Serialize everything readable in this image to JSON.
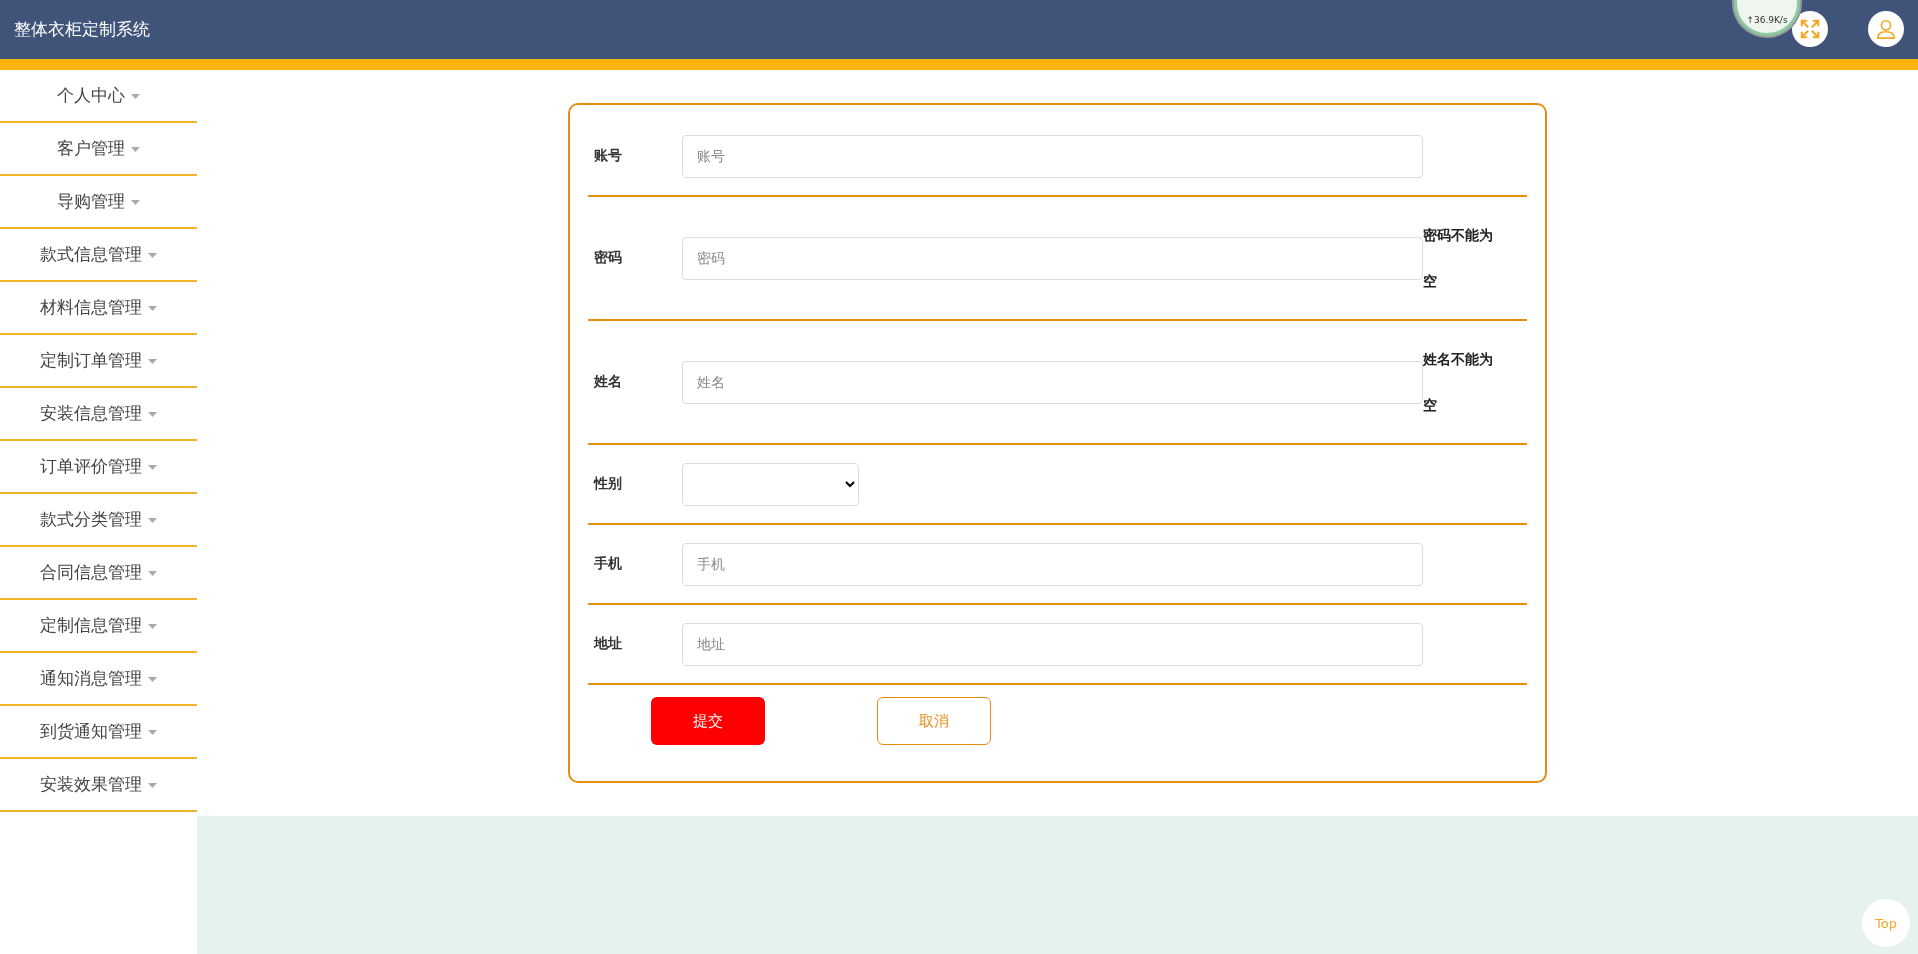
{
  "header": {
    "title": "整体衣柜定制系统",
    "speed_widget": "↑36.9K/s"
  },
  "sidebar": {
    "items": [
      {
        "label": "个人中心"
      },
      {
        "label": "客户管理"
      },
      {
        "label": "导购管理"
      },
      {
        "label": "款式信息管理"
      },
      {
        "label": "材料信息管理"
      },
      {
        "label": "定制订单管理"
      },
      {
        "label": "安装信息管理"
      },
      {
        "label": "订单评价管理"
      },
      {
        "label": "款式分类管理"
      },
      {
        "label": "合同信息管理"
      },
      {
        "label": "定制信息管理"
      },
      {
        "label": "通知消息管理"
      },
      {
        "label": "到货通知管理"
      },
      {
        "label": "安装效果管理"
      }
    ]
  },
  "form": {
    "fields": [
      {
        "kind": "text",
        "label": "账号",
        "placeholder": "账号"
      },
      {
        "kind": "text",
        "label": "密码",
        "placeholder": "密码",
        "error": "密码不能为空"
      },
      {
        "kind": "text",
        "label": "姓名",
        "placeholder": "姓名",
        "error": "姓名不能为空"
      },
      {
        "kind": "select",
        "label": "性别"
      },
      {
        "kind": "text",
        "label": "手机",
        "placeholder": "手机"
      },
      {
        "kind": "text",
        "label": "地址",
        "placeholder": "地址"
      }
    ],
    "buttons": [
      {
        "kind": "primary",
        "label": "提交"
      },
      {
        "kind": "outline",
        "label": "取消"
      }
    ]
  },
  "back_to_top": "Top"
}
